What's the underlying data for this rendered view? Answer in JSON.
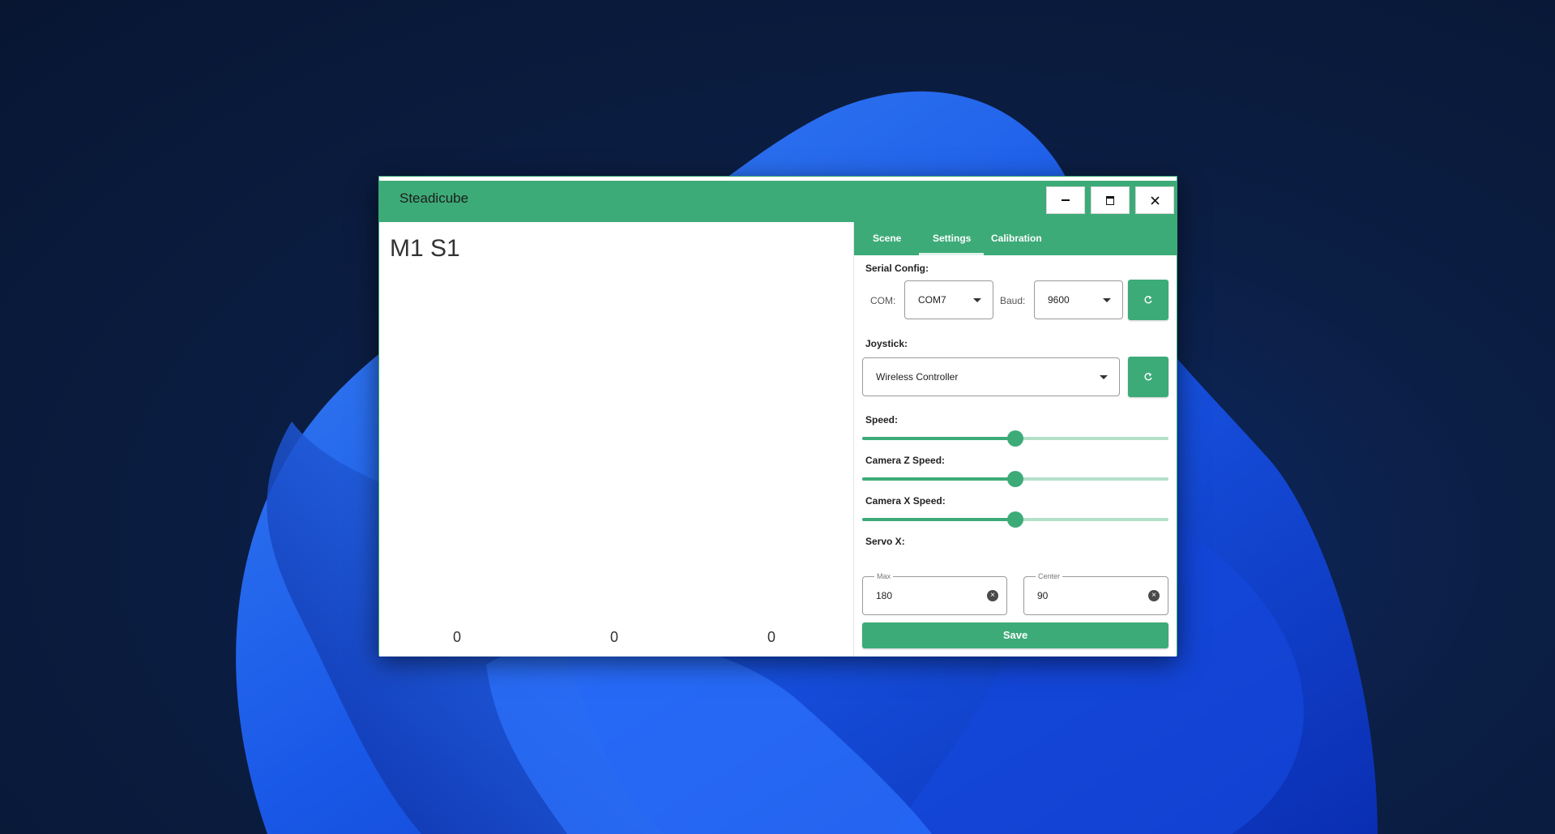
{
  "window": {
    "title": "Steadicube"
  },
  "left": {
    "motor_label": "M1 S1",
    "counters": [
      "0",
      "0",
      "0"
    ]
  },
  "tabs": {
    "items": [
      "Scene",
      "Settings",
      "Calibration"
    ],
    "active": "Settings"
  },
  "settings": {
    "serial_config_label": "Serial Config:",
    "com_label": "COM:",
    "com_value": "COM7",
    "baud_label": "Baud:",
    "baud_value": "9600",
    "joystick_label": "Joystick:",
    "joystick_value": "Wireless Controller",
    "speed_label": "Speed:",
    "speed_value": 0.5,
    "camera_z_label": "Camera Z Speed:",
    "camera_z_value": 0.5,
    "camera_x_label": "Camera X Speed:",
    "camera_x_value": 0.5,
    "servo_x_label": "Servo X:",
    "max_legend": "Max",
    "max_value": "180",
    "center_legend": "Center",
    "center_value": "90",
    "save_label": "Save"
  },
  "colors": {
    "accent": "#3dab78",
    "rail": "#b3e0c9"
  },
  "icons": [
    "minimize-icon",
    "maximize-icon",
    "close-icon",
    "refresh-icon",
    "clear-icon",
    "dropdown-caret-icon"
  ]
}
